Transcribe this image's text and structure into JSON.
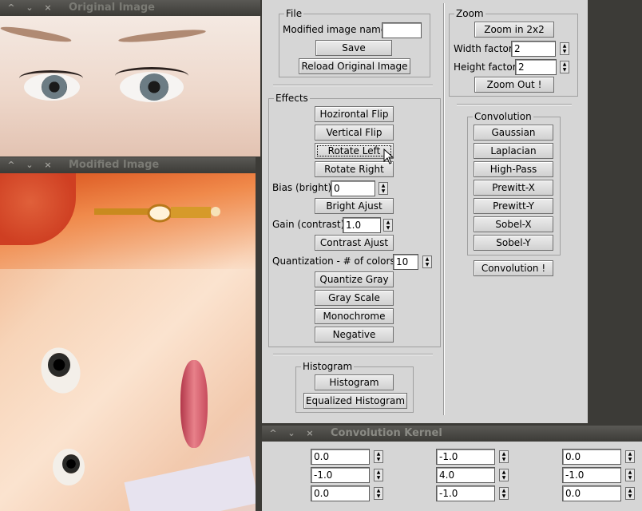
{
  "original_window": {
    "title": "Original Image"
  },
  "modified_window": {
    "title": "Modified Image"
  },
  "panel": {
    "file": {
      "legend": "File",
      "name_label": "Modified image name:",
      "name_value": "",
      "save": "Save",
      "reload": "Reload Original Image"
    },
    "zoom": {
      "legend": "Zoom",
      "zoom_in": "Zoom in 2x2",
      "width_label": "Width factor:",
      "width_value": "2",
      "height_label": "Height factor:",
      "height_value": "2",
      "zoom_out": "Zoom Out !"
    },
    "effects": {
      "legend": "Effects",
      "hflip": "Hozirontal Flip",
      "vflip": "Vertical Flip",
      "rotate_left": "Rotate Left",
      "rotate_right": "Rotate Right",
      "bias_label": "Bias (bright):",
      "bias_value": "0",
      "bright": "Bright Ajust",
      "gain_label": "Gain (contrast):",
      "gain_value": "1.0",
      "contrast": "Contrast Ajust",
      "quant_label": "Quantization - # of colors:",
      "quant_value": "10",
      "quant_gray": "Quantize Gray",
      "gray_scale": "Gray Scale",
      "monochrome": "Monochrome",
      "negative": "Negative"
    },
    "convolution": {
      "legend": "Convolution",
      "gaussian": "Gaussian",
      "laplacian": "Laplacian",
      "highpass": "High-Pass",
      "prewitt_x": "Prewitt-X",
      "prewitt_y": "Prewitt-Y",
      "sobel_x": "Sobel-X",
      "sobel_y": "Sobel-Y",
      "apply": "Convolution !"
    },
    "histogram": {
      "legend": "Histogram",
      "histogram": "Histogram",
      "equalized": "Equalized Histogram"
    }
  },
  "kernel_window": {
    "title": "Convolution Kernel",
    "cells": [
      [
        "0.0",
        "-1.0",
        "0.0"
      ],
      [
        "-1.0",
        "4.0",
        "-1.0"
      ],
      [
        "0.0",
        "-1.0",
        "0.0"
      ]
    ]
  },
  "icons": {
    "window_controls": [
      "^",
      "⌄",
      "×"
    ],
    "spin": [
      "▲",
      "▼"
    ]
  }
}
